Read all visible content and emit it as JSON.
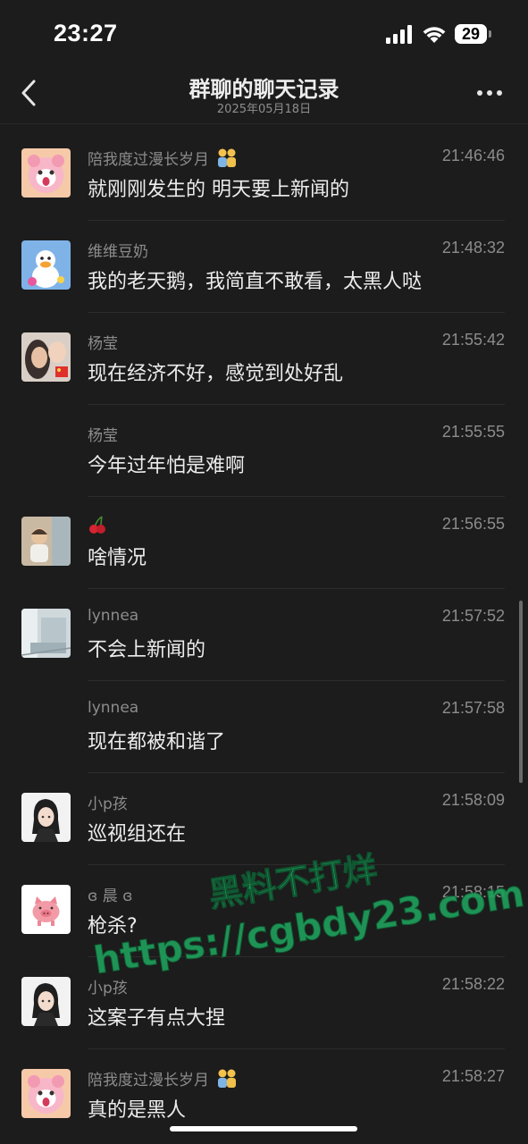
{
  "status_bar": {
    "time": "23:27",
    "battery": "29"
  },
  "header": {
    "title": "群聊的聊天记录",
    "subtitle": "2025年05月18日"
  },
  "messages": [
    {
      "sender": "陪我度过漫长岁月",
      "sender_emoji": "couple-emoji",
      "time": "21:46:46",
      "text": "就刚刚发生的 明天要上新闻的",
      "avatar": "pink-cartoon-avatar"
    },
    {
      "sender": "维维豆奶",
      "time": "21:48:32",
      "text": "我的老天鹅，我简直不敢看，太黑人哒",
      "avatar": "duck-avatar"
    },
    {
      "sender": "杨莹",
      "time": "21:55:42",
      "text": "现在经济不好，感觉到处好乱",
      "avatar": "selfie-avatar"
    },
    {
      "sender": "杨莹",
      "time": "21:55:55",
      "text": "今年过年怕是难啊",
      "avatar": ""
    },
    {
      "sender": "🍒",
      "time": "21:56:55",
      "text": "啥情况",
      "avatar": "child-photo-avatar"
    },
    {
      "sender": "lynnea",
      "time": "21:57:52",
      "text": "不会上新闻的",
      "avatar": "room-photo-avatar"
    },
    {
      "sender": "lynnea",
      "time": "21:57:58",
      "text": "现在都被和谐了",
      "avatar": ""
    },
    {
      "sender": "小p孩",
      "time": "21:58:09",
      "text": "巡视组还在",
      "avatar": "anime-girl-avatar"
    },
    {
      "sender": "ɞ 晨 ɞ",
      "time": "21:58:15",
      "text": "枪杀?",
      "avatar": "pig-avatar"
    },
    {
      "sender": "小p孩",
      "time": "21:58:22",
      "text": "这案子有点大捏",
      "avatar": "anime-girl-avatar"
    },
    {
      "sender": "陪我度过漫长岁月",
      "sender_emoji": "couple-emoji",
      "time": "21:58:27",
      "text": "真的是黑人",
      "avatar": "pink-cartoon-avatar"
    }
  ],
  "watermark": {
    "line1": "黑料不打烊",
    "line2": "https://cgbdy23.com",
    "color": "#1f9e5a"
  },
  "colors": {
    "background": "#1c1c1c",
    "secondary_text": "#8c8c8c",
    "primary_text": "#ececec"
  }
}
